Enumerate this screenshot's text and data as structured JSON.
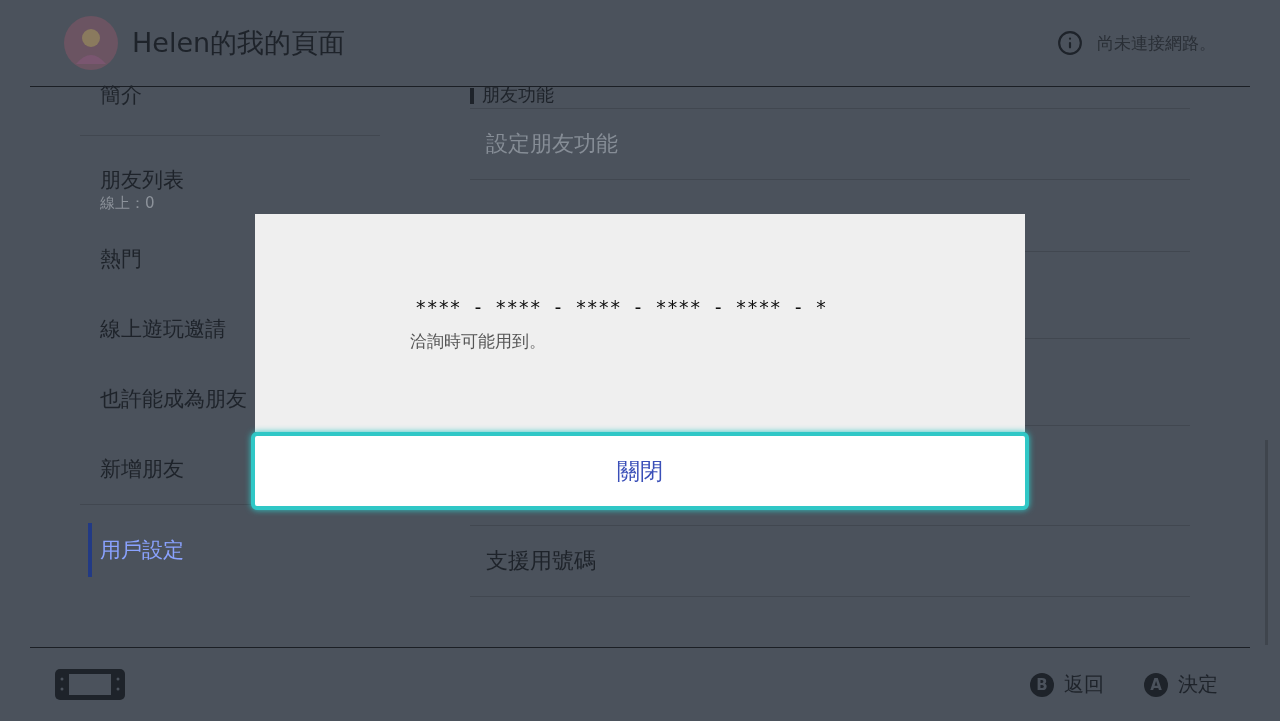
{
  "header": {
    "title": "Helen的我的頁面",
    "status": "尚未連接網路。"
  },
  "sidebar": {
    "items": [
      {
        "label": "簡介",
        "selected": false,
        "divider_after": true
      },
      {
        "label": "朋友列表",
        "sub": "線上：0",
        "selected": false
      },
      {
        "label": "熱門",
        "selected": false
      },
      {
        "label": "線上遊玩邀請",
        "selected": false
      },
      {
        "label": "也許能成為朋友",
        "selected": false
      },
      {
        "label": "新增朋友",
        "selected": false,
        "divider_after": true
      },
      {
        "label": "用戶設定",
        "selected": true
      }
    ]
  },
  "content": {
    "sections": [
      {
        "heading": "朋友功能",
        "rows": [
          {
            "label": "設定朋友功能",
            "disabled": true
          }
        ]
      },
      {
        "rows": [
          {
            "label": "支援用號碼",
            "disabled": false
          }
        ]
      }
    ]
  },
  "dialog": {
    "code": "**** - **** - **** - **** - **** - *",
    "note": "洽詢時可能用到。",
    "button": "關閉"
  },
  "footer": {
    "buttons": [
      {
        "glyph": "B",
        "label": "返回"
      },
      {
        "glyph": "A",
        "label": "決定"
      }
    ]
  }
}
